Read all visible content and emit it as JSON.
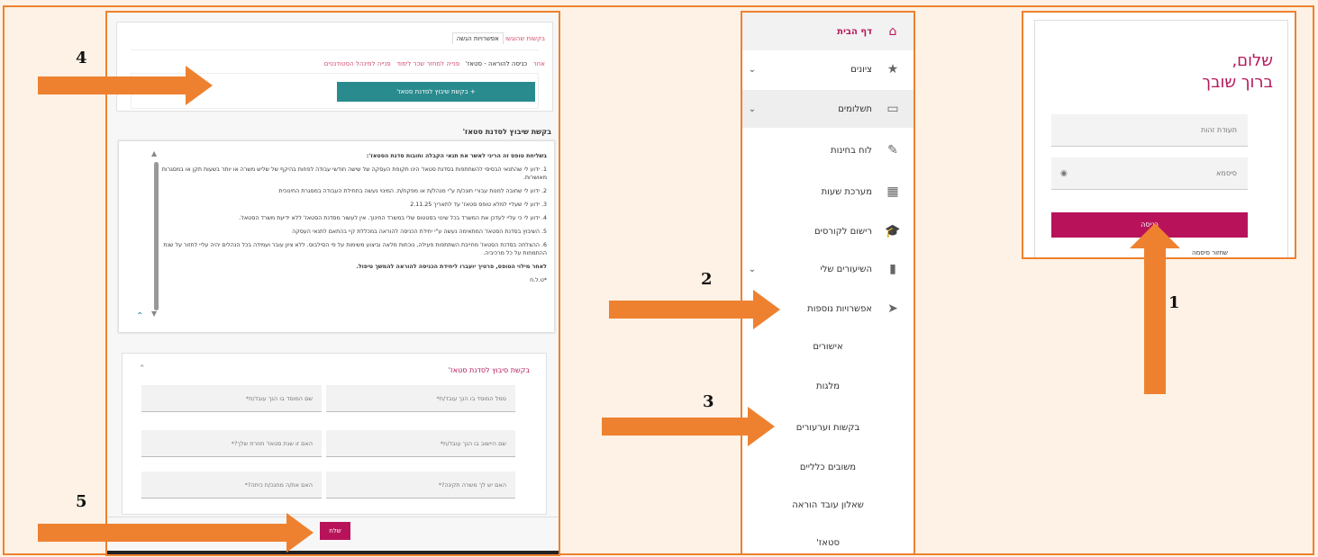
{
  "annotations": {
    "step1": "1",
    "step2": "2",
    "step3": "3",
    "step4": "4",
    "step5": "5"
  },
  "colors": {
    "arrow": "#ee8130",
    "accent": "#b8135a",
    "teal": "#2a8b8f"
  },
  "login": {
    "greeting_line1": "שלום,",
    "greeting_line2": "ברוך שובך",
    "id_placeholder": "תעודת זהות",
    "password_placeholder": "סיסמא",
    "submit_label": "כניסה",
    "forgot_label": "שחזור סיסמה"
  },
  "sidebar": {
    "items": [
      {
        "label": "דף הבית",
        "icon": "home-icon",
        "glyph": "⌂",
        "chevron": ""
      },
      {
        "label": "ציונים",
        "icon": "star-icon",
        "glyph": "★",
        "chevron": "⌄"
      },
      {
        "label": "תשלומים",
        "icon": "credit-card-icon",
        "glyph": "▭",
        "chevron": "⌄"
      },
      {
        "label": "לוח בחינות",
        "icon": "edit-icon",
        "glyph": "✎",
        "chevron": ""
      },
      {
        "label": "מערכת שעות",
        "icon": "calendar-icon",
        "glyph": "▦",
        "chevron": ""
      },
      {
        "label": "רישום לקורסים",
        "icon": "graduation-cap-icon",
        "glyph": "🎓",
        "chevron": ""
      },
      {
        "label": "השיעורים שלי",
        "icon": "book-icon",
        "glyph": "▮",
        "chevron": "⌄"
      },
      {
        "label": "אפשרויות נוספות",
        "icon": "paper-plane-icon",
        "glyph": "➤",
        "chevron": ""
      }
    ],
    "subitems": [
      "אישורים",
      "מלגות",
      "בקשות וערעורים",
      "משובים כלליים",
      "שאלון עובד הוראה",
      "סטאז'"
    ]
  },
  "form": {
    "top_tabs": {
      "link": "בקשות שהוגשו",
      "active": "אפשרויות הגשה"
    },
    "sub_tabs": [
      "כניסה להוראה - סטאז'",
      "פנייה למחזר שכר לימוד",
      "פנייה למינהל הסטודנטים",
      "אחר"
    ],
    "action_button": "+ בקשת שיבוץ לסדנת סטאז'",
    "section_title": "בקשת שיבוץ לסדנת סטאז'",
    "terms_heading": "בשליחת טופס זה הריני לאשר את תנאי הקבלה וחובות סדנת הסטאז':",
    "terms": [
      "1. ידוע לי שהתנאי הבסיסי להשתתפות בסדנת סטאז' הינו תקופת העסקה של שישה חודשי עבודה לפחות בהיקף של שליש משרה או יותר בשעות תקן או במסגרות מאושרות.",
      "2. ידוע לי שחובה למנות עבורי חונכ/ת ע\"י מנהל/ת או מפקח/ת. המינוי נעשה בתחילת העבודה במסגרת החינוכית",
      "3. ידוע לי שעליי למלא טופס סטאז' עד לתאריך 2.11.25",
      "4. ידוע לי כי עליי לעדכן את המשרד בכל שינוי בסטטוס שלי במשרד החינוך. אין לעשור מסדנת הסטאז' ללא ידיעת משרד הסטאז'.",
      "5. השיבוץ בסדנת הסטאז' המתאימה נעשה ע\"י יחידת הכניסה להוראה במכללת קיי בהתאם לתנאי העסקה",
      "6. ההצלחה בסדנת הסטאז' מחייבת השתתפות פעילה, נוכחות מלאה וביצוע משימות על פי הסילבוס. ללא ציון עובר ועמידה בכל הנהלים יהיה עליי לחזור על שנת ההתמחות על כל מרכיביה."
    ],
    "terms_footer": "לאחר מילוי הטופס, פרטיך יועברו ליחידת הכניסה להוראה להמשך טיפול.",
    "terms_sign": "*ט.ל.ח",
    "subform_title": "בקשת סיבוץ לסדנת סטאז'",
    "fields": [
      "סמל המוסד בו הנך עובד/ת*",
      "שם המוסד בו הנך עובד/ת*",
      "שם היישוב בו הנך עובד/ת*",
      "האם זו שנת סטאז' חוזרת שלך?*",
      "האם יש לך משרה תקינה?*",
      "האם את/ה מחנכ/ת כיתה?*"
    ],
    "submit_label": "שלח"
  }
}
